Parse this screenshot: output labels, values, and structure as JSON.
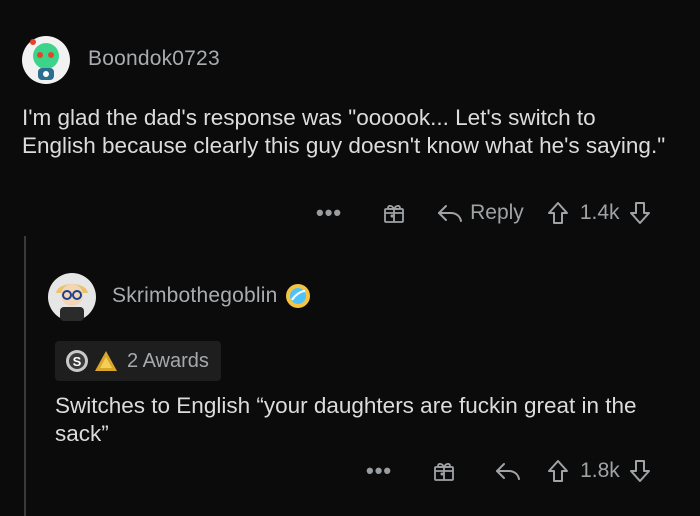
{
  "comment1": {
    "username": "Boondok0723",
    "text": "I'm glad the dad's response was \"oooook... Let's switch to English because clearly this guy doesn't know what he's saying.\"",
    "actions": {
      "more": "•••",
      "reply_label": "Reply",
      "score": "1.4k"
    }
  },
  "comment2": {
    "username": "Skrimbothegoblin",
    "awards_label": "2 Awards",
    "text": "Switches to English “your daughters are fuckin great in the sack”",
    "actions": {
      "more": "•••",
      "score": "1.8k"
    }
  },
  "icons": [
    "avatar",
    "flair-badge-icon",
    "more-icon",
    "gift-award-icon",
    "reply-icon",
    "upvote-icon",
    "downvote-icon",
    "silver-award-icon",
    "helpful-award-icon"
  ],
  "colors": {
    "background": "#0b0b0b",
    "text": "#dcdcdc",
    "muted": "#a0a3a6",
    "avatar_green": "#3bd48a"
  }
}
